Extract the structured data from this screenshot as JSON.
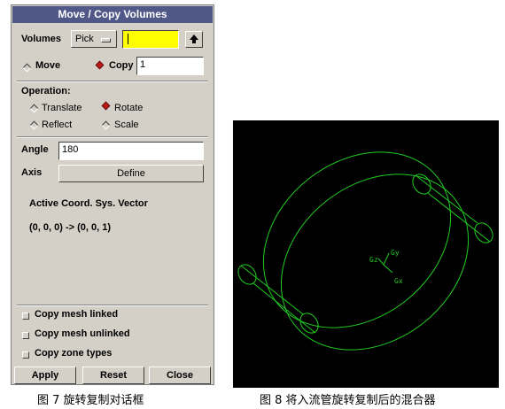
{
  "dialog": {
    "title": "Move / Copy Volumes",
    "volumes_label": "Volumes",
    "pick_button": "Pick",
    "volumes_value": "",
    "mode": {
      "move_label": "Move",
      "copy_label": "Copy",
      "selected": "Copy",
      "copy_count": "1"
    },
    "operation": {
      "label": "Operation:",
      "translate": "Translate",
      "rotate": "Rotate",
      "reflect": "Reflect",
      "scale": "Scale",
      "selected": "Rotate"
    },
    "angle": {
      "label": "Angle",
      "value": "180"
    },
    "axis": {
      "label": "Axis",
      "define_button": "Define"
    },
    "coord_vector_label": "Active Coord. Sys. Vector",
    "coord_vector_value": "(0, 0, 0) -> (0, 0, 1)",
    "options": {
      "copy_mesh_linked": "Copy mesh linked",
      "copy_mesh_unlinked": "Copy mesh unlinked",
      "copy_zone_types": "Copy zone types"
    },
    "buttons": {
      "apply": "Apply",
      "reset": "Reset",
      "close": "Close"
    }
  },
  "viewport": {
    "background": "#000000",
    "line_color": "#22cc22",
    "axis_labels": {
      "y": "Gy",
      "z": "Gz",
      "x": "Gx"
    }
  },
  "captions": {
    "left": "图 7 旋转复制对话框",
    "right": "图 8 将入流管旋转复制后的混合器"
  },
  "colors": {
    "title_bar": "#505888",
    "panel": "#d4d0c8",
    "highlight_field": "#ffff00",
    "radio_on": "#c01818"
  }
}
